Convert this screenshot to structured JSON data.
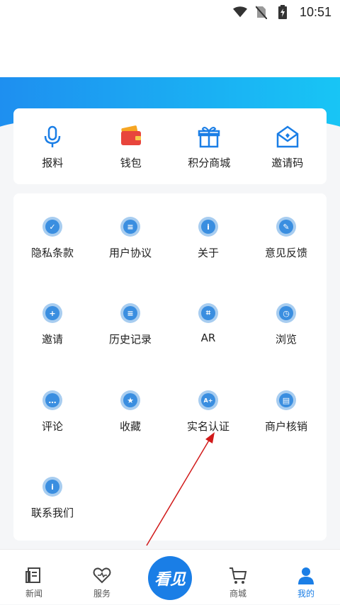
{
  "status_bar": {
    "time": "10:51"
  },
  "quick_actions": [
    {
      "label": "报料",
      "icon": "microphone-icon"
    },
    {
      "label": "钱包",
      "icon": "wallet-icon"
    },
    {
      "label": "积分商城",
      "icon": "gift-icon"
    },
    {
      "label": "邀请码",
      "icon": "envelope-icon"
    }
  ],
  "menu_items": [
    {
      "label": "隐私条款",
      "icon": "shield-icon",
      "glyph": "✓"
    },
    {
      "label": "用户协议",
      "icon": "document-icon",
      "glyph": "≡"
    },
    {
      "label": "关于",
      "icon": "info-icon",
      "glyph": "i"
    },
    {
      "label": "意见反馈",
      "icon": "feedback-icon",
      "glyph": "✎"
    },
    {
      "label": "邀请",
      "icon": "add-user-icon",
      "glyph": "+"
    },
    {
      "label": "历史记录",
      "icon": "history-icon",
      "glyph": "≡"
    },
    {
      "label": "AR",
      "icon": "ar-scan-icon",
      "glyph": "⌗"
    },
    {
      "label": "浏览",
      "icon": "clock-icon",
      "glyph": "◷"
    },
    {
      "label": "评论",
      "icon": "comment-icon",
      "glyph": "…"
    },
    {
      "label": "收藏",
      "icon": "star-icon",
      "glyph": "★"
    },
    {
      "label": "实名认证",
      "icon": "id-card-icon",
      "glyph": "A+"
    },
    {
      "label": "商户核销",
      "icon": "shop-icon",
      "glyph": "▤"
    },
    {
      "label": "联系我们",
      "icon": "info-icon",
      "glyph": "i"
    }
  ],
  "tab_bar": {
    "tabs": [
      {
        "label": "新闻",
        "icon": "news-icon",
        "active": false
      },
      {
        "label": "服务",
        "icon": "heart-icon",
        "active": false
      },
      {
        "label": "商城",
        "icon": "cart-icon",
        "active": false
      },
      {
        "label": "我的",
        "icon": "user-icon",
        "active": true
      }
    ],
    "center_button": "看见"
  },
  "colors": {
    "accent": "#1a7ee6",
    "banner_start": "#1e8ff0",
    "banner_end": "#18c5f5",
    "icon_light": "#a8cdf0",
    "icon_dark": "#3a8ee0",
    "annotation_arrow": "#d11a1a"
  }
}
